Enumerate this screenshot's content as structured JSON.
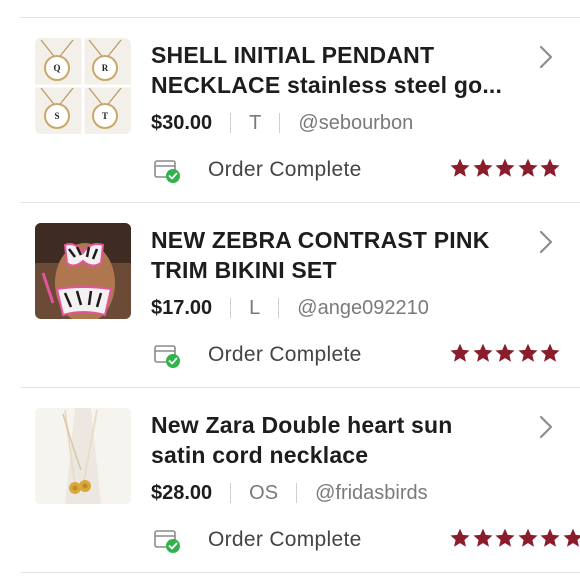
{
  "colors": {
    "star": "#8a1c2b",
    "check": "#2fb34a",
    "chevron": "#8d8d8d"
  },
  "orders": [
    {
      "title_line1": "SHELL INITIAL PENDANT",
      "title_line2": "NECKLACE stainless steel go...",
      "price": "$30.00",
      "size": "T",
      "seller": "@sebourbon",
      "status": "Order Complete",
      "rating": 5,
      "thumb_letters": [
        "Q",
        "R",
        "S",
        "T"
      ]
    },
    {
      "title_line1": "NEW ZEBRA CONTRAST PINK",
      "title_line2": "TRIM BIKINI SET",
      "price": "$17.00",
      "size": "L",
      "seller": "@ange092210",
      "status": "Order Complete",
      "rating": 5
    },
    {
      "title_line1": "New Zara Double heart sun",
      "title_line2": "satin cord necklace",
      "price": "$28.00",
      "size": "OS",
      "seller": "@fridasbirds",
      "status": "Order Complete",
      "rating": 5
    }
  ],
  "icons": {
    "chevron": "chevron-right-icon",
    "status": "order-complete-icon",
    "star": "star-icon"
  }
}
